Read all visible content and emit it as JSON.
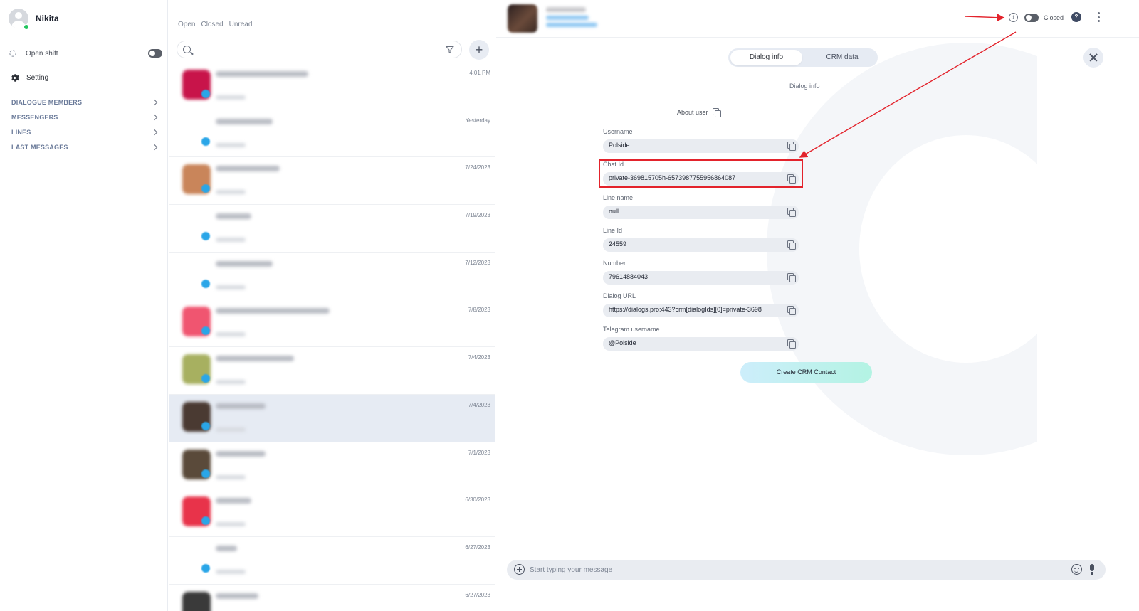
{
  "sidebar": {
    "user_name": "Nikita",
    "shift_label": "Open shift",
    "setting_label": "Setting",
    "nav_items": [
      {
        "label": "DIALOGUE MEMBERS"
      },
      {
        "label": "MESSENGERS"
      },
      {
        "label": "LINES"
      },
      {
        "label": "LAST MESSAGES"
      }
    ]
  },
  "chatlist": {
    "tabs": [
      "Open",
      "Closed",
      "Unread"
    ],
    "search": {
      "placeholder": "",
      "value": ""
    },
    "rows": [
      {
        "date": "4:01 PM",
        "pic": "#c8144a",
        "selected": false
      },
      {
        "date": "Yesterday",
        "pic": "none",
        "selected": false
      },
      {
        "date": "7/24/2023",
        "pic": "#c9855a",
        "selected": false
      },
      {
        "date": "7/19/2023",
        "pic": "none",
        "selected": false
      },
      {
        "date": "7/12/2023",
        "pic": "none",
        "selected": false
      },
      {
        "date": "7/8/2023",
        "pic": "#f05570",
        "selected": false
      },
      {
        "date": "7/4/2023",
        "pic": "#a7b060",
        "selected": false
      },
      {
        "date": "7/4/2023",
        "pic": "#4a3a32",
        "selected": true
      },
      {
        "date": "7/1/2023",
        "pic": "#5a4a3a",
        "selected": false
      },
      {
        "date": "6/30/2023",
        "pic": "#e8334a",
        "selected": false
      },
      {
        "date": "6/27/2023",
        "pic": "none",
        "selected": false
      },
      {
        "date": "6/27/2023",
        "pic": "#3a3a3a",
        "selected": false
      }
    ]
  },
  "header": {
    "status_label": "Closed",
    "help_label": "?"
  },
  "detail": {
    "tabs": {
      "dialog_info": "Dialog info",
      "crm_data": "CRM data"
    },
    "section_title": "Dialog info",
    "about_user": "About user",
    "fields": [
      {
        "label": "Username",
        "value": "Polside"
      },
      {
        "label": "Chat Id",
        "value": "private-369815705h-6573987755956864087"
      },
      {
        "label": "Line name",
        "value": "null"
      },
      {
        "label": "Line Id",
        "value": "24559"
      },
      {
        "label": "Number",
        "value": "79614884043"
      },
      {
        "label": "Dialog URL",
        "value": "https://dialogs.pro:443?crm[dialogIds][0]=private-3698"
      },
      {
        "label": "Telegram username",
        "value": "@Polside"
      }
    ],
    "create_crm_button": "Create CRM Contact"
  },
  "composer": {
    "placeholder": "Start typing your message"
  },
  "colors": {
    "accent_highlight": "#e3232c",
    "online": "#22c55e",
    "messenger_badge": "#2aa6e8"
  }
}
